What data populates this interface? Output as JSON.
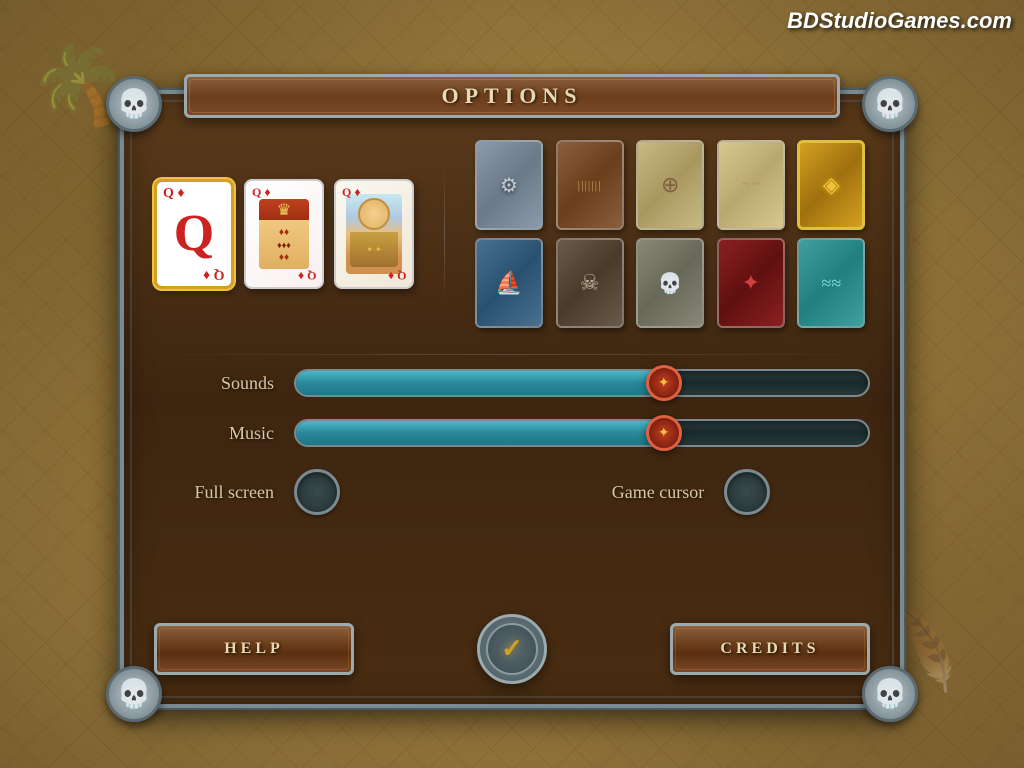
{
  "watermark": {
    "text": "BDStudioGames.com"
  },
  "panel": {
    "title": "OPTIONS"
  },
  "card_styles": {
    "selected_index": 0,
    "styles": [
      {
        "id": "plain",
        "label": "Plain Q"
      },
      {
        "id": "classic",
        "label": "Classic Queen"
      },
      {
        "id": "character",
        "label": "Character Queen"
      }
    ]
  },
  "card_backs": [
    {
      "id": "metal",
      "class": "cb-metal",
      "icon": "⚙"
    },
    {
      "id": "wood",
      "class": "cb-wood",
      "icon": "▬"
    },
    {
      "id": "compass",
      "class": "cb-compass",
      "icon": "⊕"
    },
    {
      "id": "paper",
      "class": "cb-paper",
      "icon": ""
    },
    {
      "id": "chest",
      "class": "cb-chest",
      "icon": "◈"
    },
    {
      "id": "ship",
      "class": "cb-ship",
      "icon": "⛵"
    },
    {
      "id": "skull2",
      "class": "cb-skull2",
      "icon": "☠"
    },
    {
      "id": "skull3",
      "class": "cb-skull3",
      "icon": "💀"
    },
    {
      "id": "badge",
      "class": "cb-badge",
      "icon": "✦"
    },
    {
      "id": "ocean",
      "class": "cb-ocean",
      "icon": "≈"
    }
  ],
  "controls": {
    "sounds": {
      "label": "Sounds",
      "value": 65
    },
    "music": {
      "label": "Music",
      "value": 65
    },
    "full_screen": {
      "label": "Full screen"
    },
    "game_cursor": {
      "label": "Game cursor"
    }
  },
  "buttons": {
    "help": {
      "label": "HELP"
    },
    "credits": {
      "label": "CREDITS"
    },
    "ok": {
      "label": "✓"
    }
  }
}
